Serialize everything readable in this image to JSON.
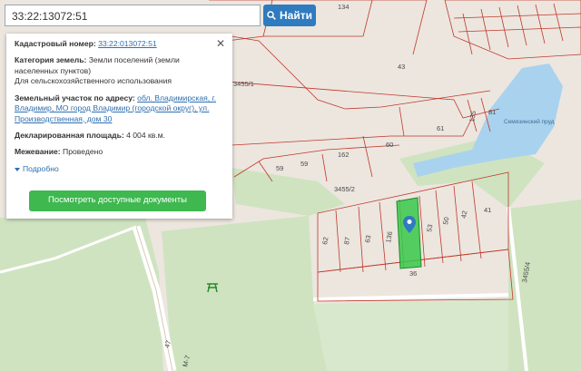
{
  "search": {
    "value": "33:22:13072:51",
    "button_label": "Найти"
  },
  "info": {
    "cadastral_label": "Кадастровый номер:",
    "cadastral_value": "33:22:013072:51",
    "category_label": "Категория земель:",
    "category_value": "Земли поселений (земли населенных пунктов)",
    "usage_value": "Для сельскохозяйственного использования",
    "address_label": "Земельный участок по адресу:",
    "address_value": "обл. Владимирская, г. Владимир, МО город Владимир (городской округ), ул. Производственная, дом 30",
    "area_label": "Декларированная площадь:",
    "area_value": "4 004 кв.м.",
    "survey_label": "Межевание:",
    "survey_value": "Проведено",
    "more_label": "Подробно",
    "docs_button": "Посмотреть доступные документы"
  },
  "map": {
    "labels": {
      "l134": "134",
      "l43": "43",
      "l3455_1": "3455/1",
      "l135": "135",
      "l81": "81",
      "l60": "60",
      "l61": "61",
      "l162": "162",
      "l59": "59",
      "l59b": "59",
      "l3455_2": "3455/2",
      "l62": "62",
      "l87": "87",
      "l63": "63",
      "l136": "136",
      "l53": "53",
      "l50": "50",
      "l42": "42",
      "l41": "41",
      "l36": "36",
      "l3455_4": "3455/4",
      "l47": "47",
      "lake": "Семязинский пруд",
      "road": "М-7"
    },
    "colors": {
      "background": "#ece6df",
      "forest": "#cfe3c0",
      "water": "#a9d2ee",
      "parcel_line": "#c0392b",
      "selected_parcel": "#39c84a",
      "road": "#f7f3ec"
    },
    "pin_icon": "location-pin-icon",
    "picnic_icon": "picnic-table-icon"
  }
}
